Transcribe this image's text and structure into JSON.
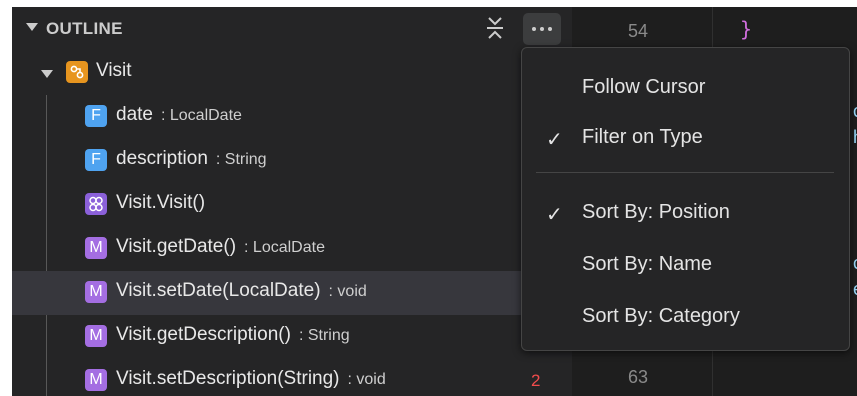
{
  "outline": {
    "title": "OUTLINE",
    "root": {
      "icon": "class-icon",
      "label": "Visit"
    },
    "items": [
      {
        "kind": "field",
        "badge": "F",
        "label": "date",
        "detail": ": LocalDate"
      },
      {
        "kind": "field",
        "badge": "F",
        "label": "description",
        "detail": ": String"
      },
      {
        "kind": "constructor",
        "badge": "",
        "label": "Visit.Visit()",
        "detail": ""
      },
      {
        "kind": "method",
        "badge": "M",
        "label": "Visit.getDate()",
        "detail": ": LocalDate"
      },
      {
        "kind": "method",
        "badge": "M",
        "label": "Visit.setDate(LocalDate)",
        "detail": ": void"
      },
      {
        "kind": "method",
        "badge": "M",
        "label": "Visit.getDescription()",
        "detail": ": String"
      },
      {
        "kind": "method",
        "badge": "M",
        "label": "Visit.setDescription(String)",
        "detail": ": void",
        "problems": "2"
      }
    ]
  },
  "editor": {
    "line_top": "54",
    "line_bottom": "63",
    "brace": "}",
    "fragments": [
      "c",
      "h",
      "c",
      "e"
    ]
  },
  "menu": {
    "items": [
      {
        "label": "Follow Cursor",
        "checked": false
      },
      {
        "label": "Filter on Type",
        "checked": true
      },
      {
        "label": "Sort By: Position",
        "checked": true
      },
      {
        "label": "Sort By: Name",
        "checked": false
      },
      {
        "label": "Sort By: Category",
        "checked": false
      }
    ],
    "check_glyph": "✓"
  },
  "colors": {
    "panel_bg": "#252526",
    "field_badge": "#4fa3f0",
    "method_badge": "#a46ee2",
    "class_badge": "#e7951f",
    "error": "#f14c4c"
  }
}
